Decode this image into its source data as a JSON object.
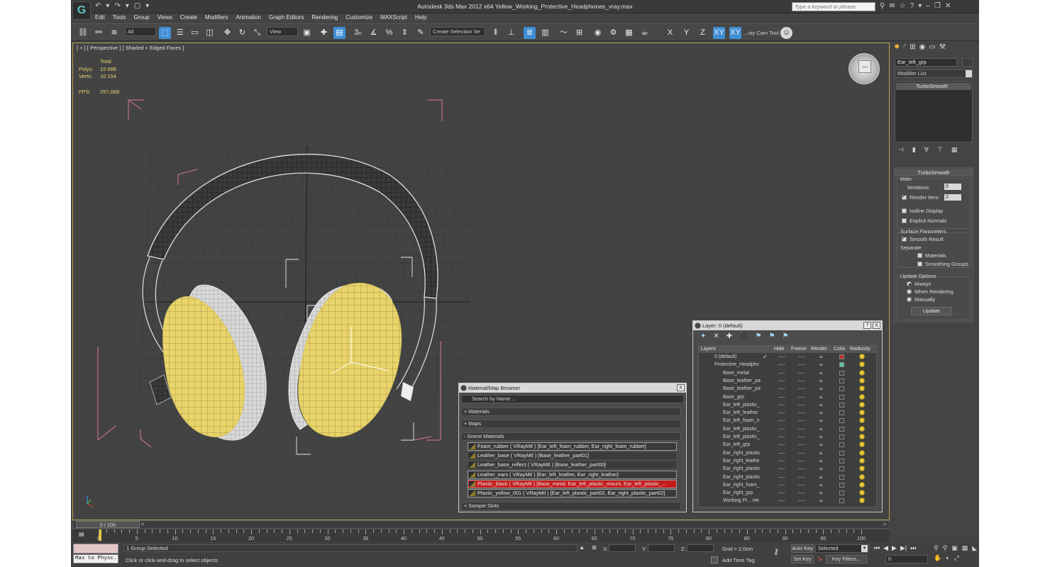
{
  "window": {
    "title": "Autodesk 3ds Max  2012 x64     Yellow_Working_Protective_Headphones_vray.max",
    "search_placeholder": "Type a keyword or phrase",
    "logo_glyph": "G"
  },
  "menu": [
    "Edit",
    "Tools",
    "Group",
    "Views",
    "Create",
    "Modifiers",
    "Animation",
    "Graph Editors",
    "Rendering",
    "Customize",
    "MAXScript",
    "Help"
  ],
  "toolbar": {
    "selection_filter": "All",
    "ref_coord": "View",
    "named_selection": "Create Selection Se",
    "cam_tool_label": "...uty Cam Tool",
    "axis_buttons": [
      "X",
      "Y",
      "Z",
      "XY",
      "XY"
    ]
  },
  "viewport": {
    "label": "[ + ] [ Perspective ] [ Shaded + Edged Faces ]",
    "stats": {
      "header": "Total",
      "polys_label": "Polys:",
      "polys": "19 688",
      "verts_label": "Verts:",
      "verts": "10 154",
      "fps_label": "FPS:",
      "fps": "297,088"
    },
    "viewcube_label": "TOP"
  },
  "command_panel": {
    "object_name": "Ear_left_grp",
    "modifier_list": "Modifier List",
    "stack_item": "TurboSmooth",
    "rollout": {
      "title": "TurboSmooth",
      "main": "Main",
      "iterations_label": "Iterations:",
      "iterations": "0",
      "render_iters_label": "Render Iters:",
      "render_iters": "2",
      "isoline": "Isoline Display",
      "explicit": "Explicit Normals",
      "surface_params": "Surface Parameters",
      "smooth_result": "Smooth Result",
      "separate": "Separate",
      "materials": "Materials",
      "smoothing_groups": "Smoothing Groups",
      "update_options": "Update Options",
      "always": "Always",
      "when_rendering": "When Rendering",
      "manually": "Manually",
      "update_btn": "Update"
    }
  },
  "layer_dialog": {
    "title": "Layer: 0 (default)",
    "help_btn": "?",
    "close_btn": "X",
    "columns": [
      "Layers",
      "Hide",
      "Freeze",
      "Render",
      "Color",
      "Radiosity"
    ],
    "rows": [
      {
        "name": "0 (default)",
        "indent": 0,
        "active": true,
        "color": "#b8321f"
      },
      {
        "name": "Protective_Headphc",
        "indent": 0,
        "active": false,
        "color": "#56c7a0"
      },
      {
        "name": "Base_metal",
        "indent": 1,
        "color": ""
      },
      {
        "name": "Base_leather_pa",
        "indent": 1,
        "color": ""
      },
      {
        "name": "Base_leather_pa",
        "indent": 1,
        "color": ""
      },
      {
        "name": "Base_grp",
        "indent": 1,
        "color": ""
      },
      {
        "name": "Ear_left_plastic_",
        "indent": 1,
        "color": ""
      },
      {
        "name": "Ear_left_leather",
        "indent": 1,
        "color": ""
      },
      {
        "name": "Ear_left_foam_n",
        "indent": 1,
        "color": ""
      },
      {
        "name": "Ear_left_plastic_",
        "indent": 1,
        "color": ""
      },
      {
        "name": "Ear_left_plastic_",
        "indent": 1,
        "color": ""
      },
      {
        "name": "Ear_left_grp",
        "indent": 1,
        "color": ""
      },
      {
        "name": "Ear_right_plastic",
        "indent": 1,
        "color": ""
      },
      {
        "name": "Ear_right_leathe",
        "indent": 1,
        "color": ""
      },
      {
        "name": "Ear_right_plastic",
        "indent": 1,
        "color": ""
      },
      {
        "name": "Ear_right_plastic",
        "indent": 1,
        "color": ""
      },
      {
        "name": "Ear_right_foam_",
        "indent": 1,
        "color": ""
      },
      {
        "name": "Ear_right_grp",
        "indent": 1,
        "color": ""
      },
      {
        "name": "Working Pr... He",
        "indent": 1,
        "color": ""
      }
    ]
  },
  "material_browser": {
    "title": "Material/Map Browser",
    "close_btn": "X",
    "search": "Search by Name ...",
    "sections": {
      "materials": "+ Materials",
      "maps": "+ Maps",
      "scene": "- Scene Materials",
      "samples": "+ Sample Slots"
    },
    "scene_materials": [
      {
        "text": "Foam_rubber  ( VRayMtl )  [Ear_left_foam_rubber, Ear_right_foam_rubber]",
        "style": "box"
      },
      {
        "text": "Leather_base  ( VRayMtl )  [Base_leather_part01]",
        "style": "plain"
      },
      {
        "text": "Leather_base_reflect  ( VRayMtl )  [Base_leather_part00]",
        "style": "plain"
      },
      {
        "text": "Leather_ears  ( VRayMtl )  [Ear_left_leather, Ear_right_leather]",
        "style": "box"
      },
      {
        "text": "Plastic_black  ( VRayMtl )  [Base_metal, Ear_left_plastic_mount, Ear_left_plastic_...",
        "style": "red"
      },
      {
        "text": "Plastic_yellow_001  ( VRayMtl )  [Ear_left_plastic_part02, Ear_right_plastic_part02]",
        "style": "box"
      }
    ]
  },
  "timeline": {
    "slider": "0 / 100",
    "prev": "<",
    "next": ">",
    "ticks": [
      "0",
      "5",
      "10",
      "15",
      "20",
      "25",
      "30",
      "35",
      "40",
      "45",
      "50",
      "55",
      "60",
      "65",
      "70",
      "75",
      "80",
      "85",
      "90",
      "95",
      "100"
    ]
  },
  "statusbar": {
    "maxscript": "Max to Physc.",
    "selection": "1 Group Selected",
    "prompt": "Click or click-and-drag to select objects",
    "x_label": "X:",
    "y_label": "Y:",
    "z_label": "Z:",
    "grid": "Grid = 2,0cm",
    "add_time_tag": "Add Time Tag",
    "auto_key": "Auto Key",
    "set_key": "Set Key",
    "selected": "Selected",
    "key_filters": "Key Filters...",
    "frame": "0"
  },
  "colors": {
    "accent_blue": "#3f8fd6",
    "viewport_border": "#b5a253",
    "headphone_yellow": "#e9d46a",
    "stats_yellow": "#e6d36b"
  }
}
